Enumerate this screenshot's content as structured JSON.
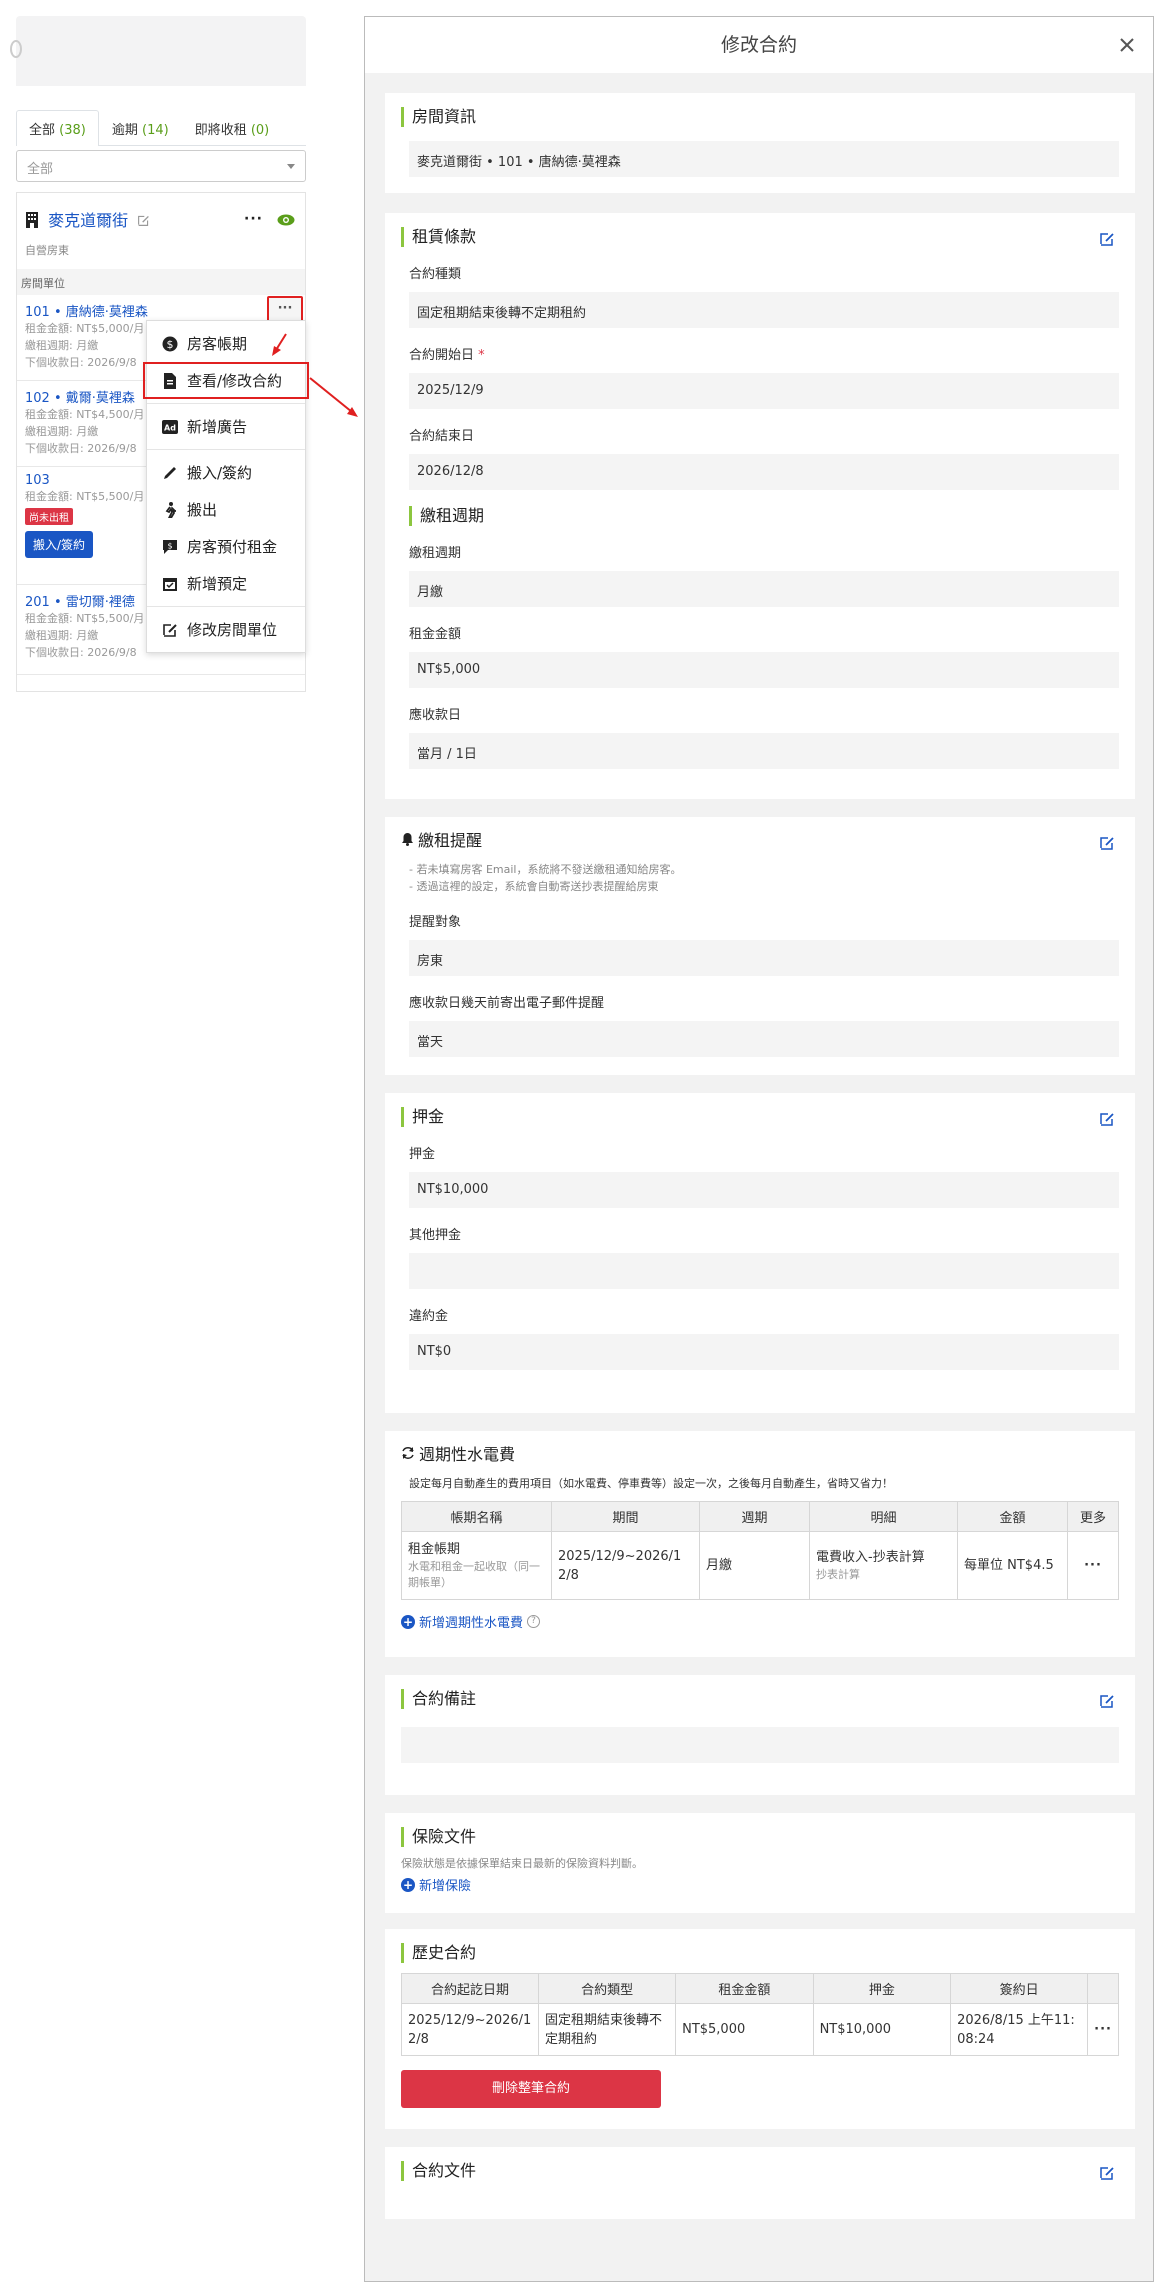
{
  "left": {
    "tabs": [
      {
        "label": "全部",
        "count": "(38)"
      },
      {
        "label": "逾期",
        "count": "(14)"
      },
      {
        "label": "即將收租",
        "count": "(0)"
      }
    ],
    "filter_value": "全部",
    "building": {
      "name": "麥克道爾街",
      "subtitle": "自營房東"
    },
    "section_label": "房間單位",
    "units": [
      {
        "name": "101 • 唐納德·莫裡森",
        "rent": "租金金額: NT$5,000/月",
        "cycle": "繳租週期: 月繳",
        "next": "下個收款日: 2026/9/8"
      },
      {
        "name": "102 • 戴爾·莫裡森",
        "rent": "租金金額: NT$4,500/月",
        "cycle": "繳租週期: 月繳",
        "next": "下個收款日: 2026/9/8"
      },
      {
        "name": "103",
        "rent": "租金金額: NT$5,500/月",
        "badge": "尚未出租",
        "button": "搬入/簽約"
      },
      {
        "name": "201 • 雷切爾·裡德",
        "rent": "租金金額: NT$5,500/月",
        "cycle": "繳租週期: 月繳",
        "next": "下個收款日: 2026/9/8"
      }
    ],
    "menu": [
      {
        "icon": "dollar-icon",
        "label": "房客帳期"
      },
      {
        "icon": "document-icon",
        "label": "查看/修改合約"
      },
      {
        "icon": "ad-icon",
        "label": "新增廣告"
      },
      {
        "icon": "pen-icon",
        "label": "搬入/簽約"
      },
      {
        "icon": "walking-icon",
        "label": "搬出"
      },
      {
        "icon": "prepay-icon",
        "label": "房客預付租金"
      },
      {
        "icon": "calendar-icon",
        "label": "新增預定"
      },
      {
        "icon": "edit-icon",
        "label": "修改房間單位"
      }
    ]
  },
  "modal": {
    "title": "修改合約",
    "room_info": {
      "title": "房間資訊",
      "value": "麥克道爾街 • 101 • 唐納德·莫裡森"
    },
    "lease_terms": {
      "title": "租賃條款",
      "fields": [
        {
          "label": "合約種類",
          "value": "固定租期結束後轉不定期租約"
        },
        {
          "label": "合約開始日",
          "required": "*",
          "value": "2025/12/9"
        },
        {
          "label": "合約結束日",
          "value": "2026/12/8"
        }
      ],
      "cycle_title": "繳租週期",
      "cycle_fields": [
        {
          "label": "繳租週期",
          "value": "月繳"
        },
        {
          "label": "租金金額",
          "value": "NT$5,000"
        },
        {
          "label": "應收款日",
          "value": "當月 / 1日"
        }
      ]
    },
    "reminder": {
      "title": "繳租提醒",
      "notes": [
        "- 若未填寫房客 Email，系統將不發送繳租通知給房客。",
        "- 透過這裡的設定，系統會自動寄送抄表提醒給房東"
      ],
      "fields": [
        {
          "label": "提醒對象",
          "value": "房東"
        },
        {
          "label": "應收款日幾天前寄出電子郵件提醒",
          "value": "當天"
        }
      ]
    },
    "deposit": {
      "title": "押金",
      "fields": [
        {
          "label": "押金",
          "value": "NT$10,000"
        },
        {
          "label": "其他押金",
          "value": ""
        },
        {
          "label": "違約金",
          "value": "NT$0"
        }
      ]
    },
    "utilities": {
      "title": "週期性水電費",
      "desc": "設定每月自動產生的費用項目（如水電費、停車費等）設定一次，之後每月自動產生，省時又省力！",
      "headers": [
        "帳期名稱",
        "期間",
        "週期",
        "明細",
        "金額",
        "更多"
      ],
      "rows": [
        {
          "name": "租金帳期",
          "name_sub": "水電和租金一起收取（同一期帳單）",
          "period": "2025/12/9~2026/12/8",
          "cycle": "月繳",
          "detail": "電費收入-抄表計算",
          "detail_sub": "抄表計算",
          "amount": "每單位 NT$4.5",
          "more": "···"
        }
      ],
      "add_label": "新增週期性水電費",
      "help": "?"
    },
    "remarks": {
      "title": "合約備註",
      "value": ""
    },
    "insurance": {
      "title": "保險文件",
      "note": "保險狀態是依據保單結束日最新的保險資料判斷。",
      "add_label": "新增保險"
    },
    "history": {
      "title": "歷史合約",
      "headers": [
        "合約起訖日期",
        "合約類型",
        "租金金額",
        "押金",
        "簽約日",
        ""
      ],
      "rows": [
        {
          "dates": "2025/12/9~2026/12/8",
          "type": "固定租期結束後轉不定期租約",
          "rent": "NT$5,000",
          "deposit": "NT$10,000",
          "signed": "2026/8/15 上午11:08:24",
          "more": "···"
        }
      ],
      "delete_label": "刪除整筆合約"
    },
    "docs": {
      "title": "合約文件"
    }
  },
  "colors": {
    "accent": "#8cc63f",
    "link": "#1a56c4",
    "danger": "#dc3545",
    "highlight": "#e02020"
  }
}
